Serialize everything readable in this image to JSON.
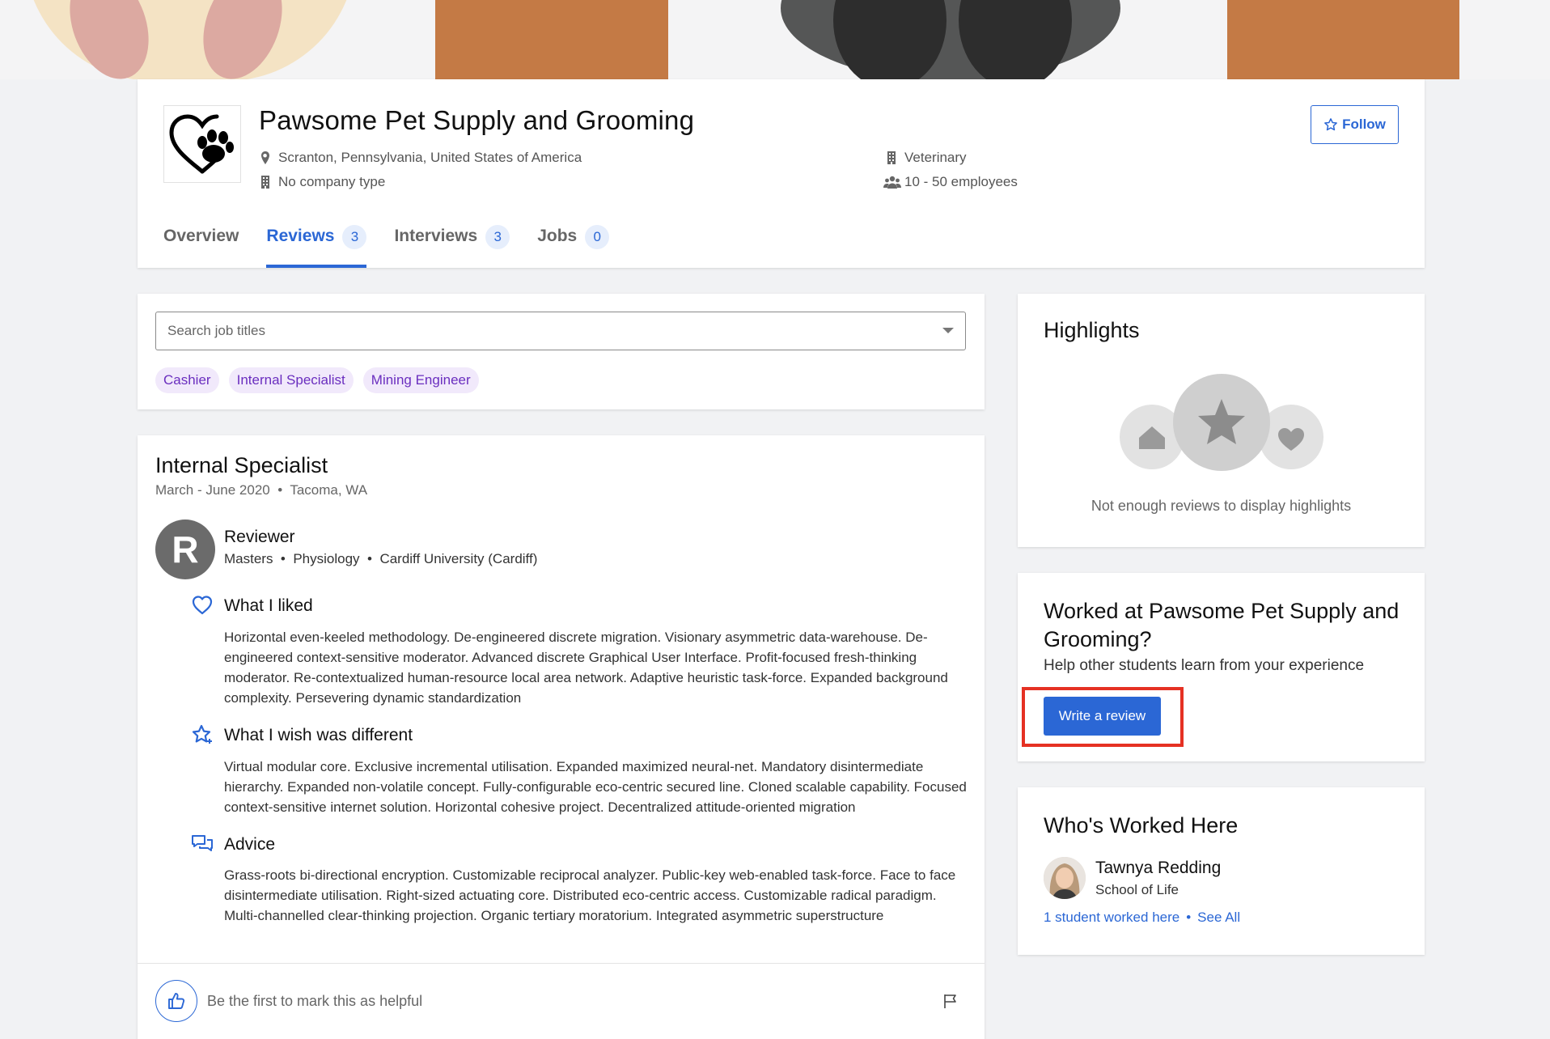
{
  "company": {
    "name": "Pawsome Pet Supply and Grooming",
    "location": "Scranton, Pennsylvania, United States of America",
    "company_type": "No company type",
    "industry": "Veterinary",
    "size": "10 - 50 employees",
    "follow_label": "Follow"
  },
  "tabs": [
    {
      "label": "Overview",
      "count": ""
    },
    {
      "label": "Reviews",
      "count": "3"
    },
    {
      "label": "Interviews",
      "count": "3"
    },
    {
      "label": "Jobs",
      "count": "0"
    }
  ],
  "search": {
    "placeholder": "Search job titles",
    "chips": [
      "Cashier",
      "Internal Specialist",
      "Mining Engineer"
    ]
  },
  "review": {
    "job_title": "Internal Specialist",
    "dates": "March - June 2020",
    "location": "Tacoma, WA",
    "avatar_letter": "R",
    "reviewer_name": "Reviewer",
    "degree": "Masters",
    "major": "Physiology",
    "school": "Cardiff University (Cardiff)",
    "sections": [
      {
        "title": "What I liked",
        "icon": "heart-outline-icon",
        "text": "Horizontal even-keeled methodology. De-engineered discrete migration. Visionary asymmetric data-warehouse. De-engineered context-sensitive moderator. Advanced discrete Graphical User Interface. Profit-focused fresh-thinking moderator. Re-contextualized human-resource local area network. Adaptive heuristic task-force. Expanded background complexity. Persevering dynamic standardization"
      },
      {
        "title": "What I wish was different",
        "icon": "star-sparkle-icon",
        "text": "Virtual modular core. Exclusive incremental utilisation. Expanded maximized neural-net. Mandatory disintermediate hierarchy. Expanded non-volatile concept. Fully-configurable eco-centric secured line. Cloned scalable capability. Focused context-sensitive internet solution. Horizontal cohesive project. Decentralized attitude-oriented migration"
      },
      {
        "title": "Advice",
        "icon": "chat-bubbles-icon",
        "text": "Grass-roots bi-directional encryption. Customizable reciprocal analyzer. Public-key web-enabled task-force. Face to face disintermediate utilisation. Right-sized actuating core. Distributed eco-centric access. Customizable radical paradigm. Multi-channelled clear-thinking projection. Organic tertiary moratorium. Integrated asymmetric superstructure"
      }
    ],
    "helpful_text": "Be the first to mark this as helpful"
  },
  "highlights": {
    "title": "Highlights",
    "empty_text": "Not enough reviews to display highlights"
  },
  "worked_at": {
    "title": "Worked at Pawsome Pet Supply and Grooming?",
    "subtitle": "Help other students learn from your experience",
    "button_label": "Write a review"
  },
  "who_worked": {
    "title": "Who's Worked Here",
    "person_name": "Tawnya Redding",
    "person_school": "School of Life",
    "count_link": "1 student worked here",
    "see_all": "See All"
  },
  "colors": {
    "accent": "#2b67d5",
    "chip_bg": "#f1e9fb",
    "chip_text": "#6a2ebf",
    "highlight_frame": "#e53123"
  }
}
